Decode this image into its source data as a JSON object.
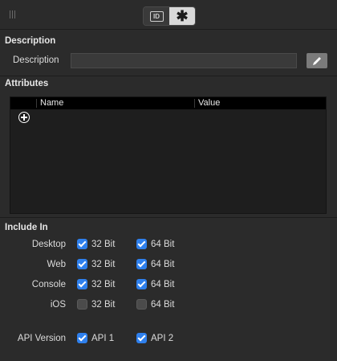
{
  "toolbar": {
    "tabs": [
      {
        "icon": "id-card-icon",
        "active": false
      },
      {
        "icon": "gear-asterisk-icon",
        "active": true
      }
    ]
  },
  "description_section": {
    "title": "Description",
    "field_label": "Description",
    "field_value": ""
  },
  "attributes_section": {
    "title": "Attributes",
    "columns": [
      "Name",
      "Value"
    ],
    "rows": []
  },
  "include_section": {
    "title": "Include In",
    "rows": [
      {
        "label": "Desktop",
        "options": [
          {
            "label": "32 Bit",
            "checked": true
          },
          {
            "label": "64 Bit",
            "checked": true
          }
        ]
      },
      {
        "label": "Web",
        "options": [
          {
            "label": "32 Bit",
            "checked": true
          },
          {
            "label": "64 Bit",
            "checked": true
          }
        ]
      },
      {
        "label": "Console",
        "options": [
          {
            "label": "32 Bit",
            "checked": true
          },
          {
            "label": "64 Bit",
            "checked": true
          }
        ]
      },
      {
        "label": "iOS",
        "options": [
          {
            "label": "32 Bit",
            "checked": false
          },
          {
            "label": "64 Bit",
            "checked": false
          }
        ]
      }
    ],
    "api": {
      "label": "API Version",
      "options": [
        {
          "label": "API 1",
          "checked": true
        },
        {
          "label": "API 2",
          "checked": true
        }
      ]
    }
  },
  "colors": {
    "panel_bg": "#2b2b2b",
    "checkbox_on": "#2f80ed",
    "table_bg": "#1e1e1e"
  }
}
